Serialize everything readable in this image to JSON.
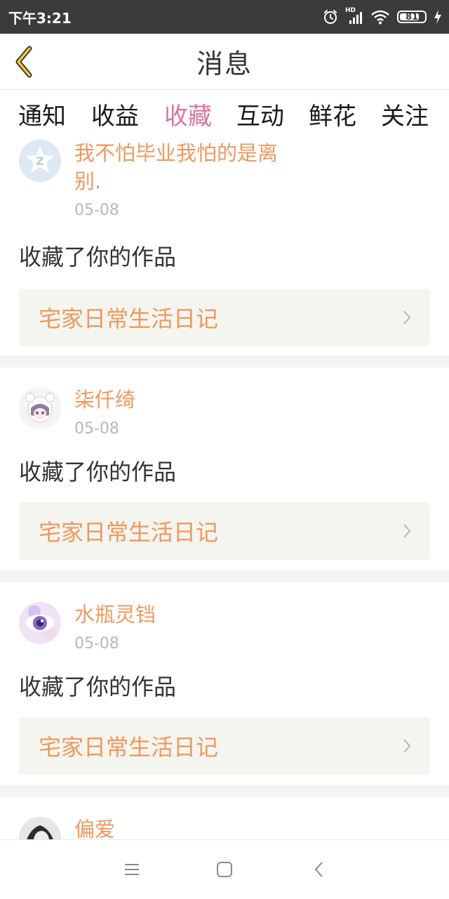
{
  "status_bar": {
    "time": "下午3:21",
    "network_label": "HD",
    "battery_percent": "81",
    "battery_level": 0.81
  },
  "header": {
    "title": "消息",
    "back_icon": "chevron-left-icon"
  },
  "tabs": [
    {
      "label": "通知",
      "active": false
    },
    {
      "label": "收益",
      "active": false
    },
    {
      "label": "收藏",
      "active": true
    },
    {
      "label": "互动",
      "active": false
    },
    {
      "label": "鲜花",
      "active": false
    },
    {
      "label": "关注",
      "active": false
    }
  ],
  "feed": {
    "items": [
      {
        "username_line1": "我不怕毕业我怕的是离",
        "username_line2": "别.",
        "date": "05-08",
        "action": "收藏了你的作品",
        "work_title": "宅家日常生活日记",
        "avatar": "default-qq-avatar"
      },
      {
        "username": "柒仟绮",
        "date": "05-08",
        "action": "收藏了你的作品",
        "work_title": "宅家日常生活日记",
        "avatar": "anime-girl-avatar"
      },
      {
        "username": "水瓶灵铛",
        "date": "05-08",
        "action": "收藏了你的作品",
        "work_title": "宅家日常生活日记",
        "avatar": "purple-eye-avatar"
      },
      {
        "username": "偏爱",
        "avatar": "photo-avatar"
      }
    ]
  },
  "nav_bar": {
    "menu_icon": "menu-icon",
    "home_icon": "home-square-icon",
    "back_icon": "back-triangle-icon"
  },
  "colors": {
    "accent_pink": "#e0729d",
    "username_orange": "#f0985e",
    "card_bg": "#f5f5ef",
    "status_bar_bg": "#3b3b3b"
  }
}
